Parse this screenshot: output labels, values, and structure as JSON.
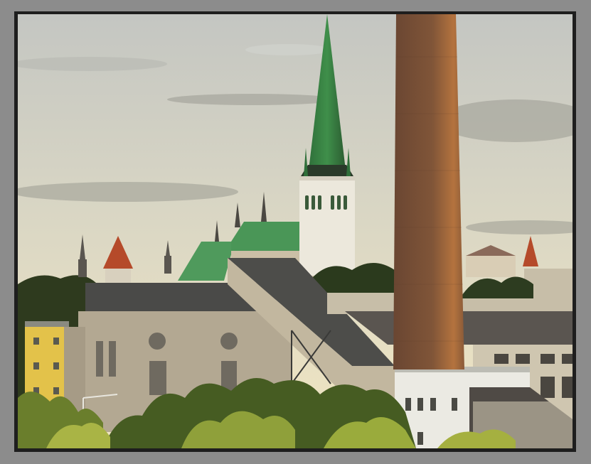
{
  "scene": {
    "subject": "old-town-skyline-with-church-spire-and-chimney",
    "palette": {
      "sky_top": "#c6c8c4",
      "sky_bottom": "#efe6c8",
      "spire_green": "#3e8a4a",
      "roof_green": "#4f9a5c",
      "tower_white": "#ece8dc",
      "chimney": "#7a4f35",
      "chimney_lit": "#b8763f",
      "building_stone": "#b9ad97",
      "roof_dark": "#4a4a48",
      "red_roof": "#b54a2a",
      "yellow_house": "#e6c54a",
      "foliage": "#5f7a2e",
      "frame_outer": "#8c8c8c",
      "frame_inner": "#1e1e1e"
    }
  }
}
